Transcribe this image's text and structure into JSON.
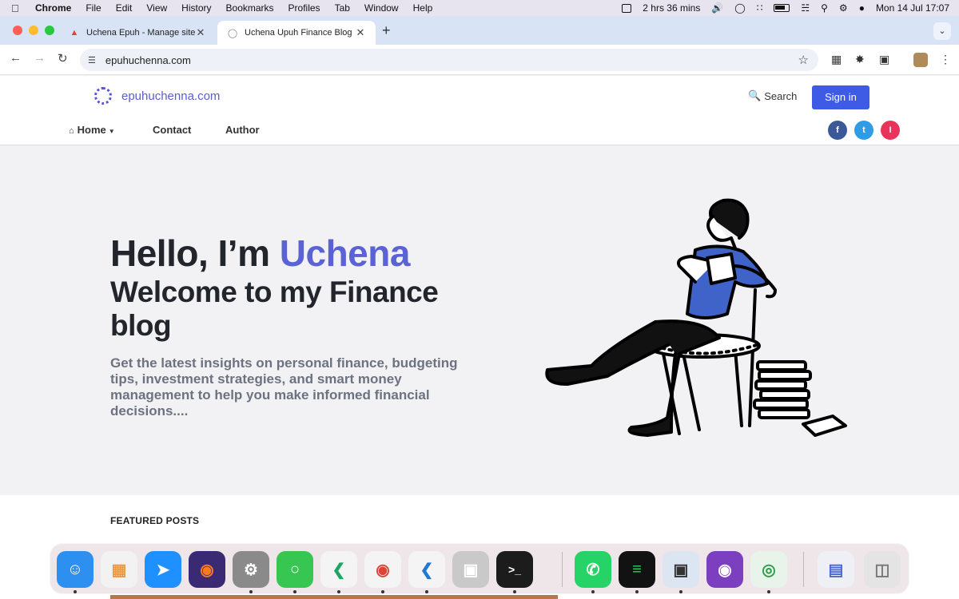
{
  "menubar": {
    "app": "Chrome",
    "items": [
      "File",
      "Edit",
      "View",
      "History",
      "Bookmarks",
      "Profiles",
      "Tab",
      "Window",
      "Help"
    ],
    "timer": "2 hrs 36 mins",
    "datetime": "Mon 14 Jul  17:07"
  },
  "browser": {
    "tabs": [
      {
        "title": "Uchena Epuh - Manage site -",
        "active": false
      },
      {
        "title": "Uchena Upuh Finance Blog",
        "active": true
      }
    ],
    "url": "epuhuchenna.com"
  },
  "site": {
    "logo_text": "epuhuchenna.com",
    "search_label": "Search",
    "signin_label": "Sign in",
    "nav": [
      {
        "label": "Home"
      },
      {
        "label": "Contact"
      },
      {
        "label": "Author"
      }
    ],
    "social": [
      {
        "letter": "f",
        "color": "#3b5998",
        "icon": "facebook-icon"
      },
      {
        "letter": "t",
        "color": "#2f9ce6",
        "icon": "twitter-icon"
      },
      {
        "letter": "I",
        "color": "#e8335a",
        "icon": "instagram-icon"
      }
    ]
  },
  "hero": {
    "hello_prefix": "Hello, I’m ",
    "hello_name": "Uchena",
    "welcome": "Welcome to my Finance blog",
    "description": "Get the latest insights on personal finance, budgeting tips, investment strategies, and smart money management to help you make informed financial decisions....",
    "accent_color": "#5b62d3"
  },
  "featured": {
    "title": "FEATURED POSTS"
  },
  "dock": [
    {
      "name": "finder-icon",
      "color": "#2d8ff0"
    },
    {
      "name": "launchpad-icon",
      "color": "#f2f2f2"
    },
    {
      "name": "safari-icon",
      "color": "#1e90ff"
    },
    {
      "name": "firefox-icon",
      "color": "#3a2a73"
    },
    {
      "name": "system-settings-icon",
      "color": "#8a8a8a"
    },
    {
      "name": "messages-icon",
      "color": "#38c653"
    },
    {
      "name": "vscode-insiders-icon",
      "color": "#1fa463"
    },
    {
      "name": "chrome-icon",
      "color": "#f4f4f4"
    },
    {
      "name": "vscode-icon",
      "color": "#1f78d1"
    },
    {
      "name": "roblox-icon",
      "color": "#c9c9c9"
    },
    {
      "name": "terminal-icon",
      "color": "#1c1c1c"
    },
    {
      "name": "whatsapp-icon",
      "color": "#25d366"
    },
    {
      "name": "spotify-icon",
      "color": "#121212"
    },
    {
      "name": "preview-icon",
      "color": "#dce6f2"
    },
    {
      "name": "github-desktop-icon",
      "color": "#7b3fbf"
    },
    {
      "name": "network-radar-icon",
      "color": "#8fc59a"
    },
    {
      "name": "recent-window-icon",
      "color": "#eef0f6"
    },
    {
      "name": "trash-icon",
      "color": "#e4e4e4"
    }
  ]
}
